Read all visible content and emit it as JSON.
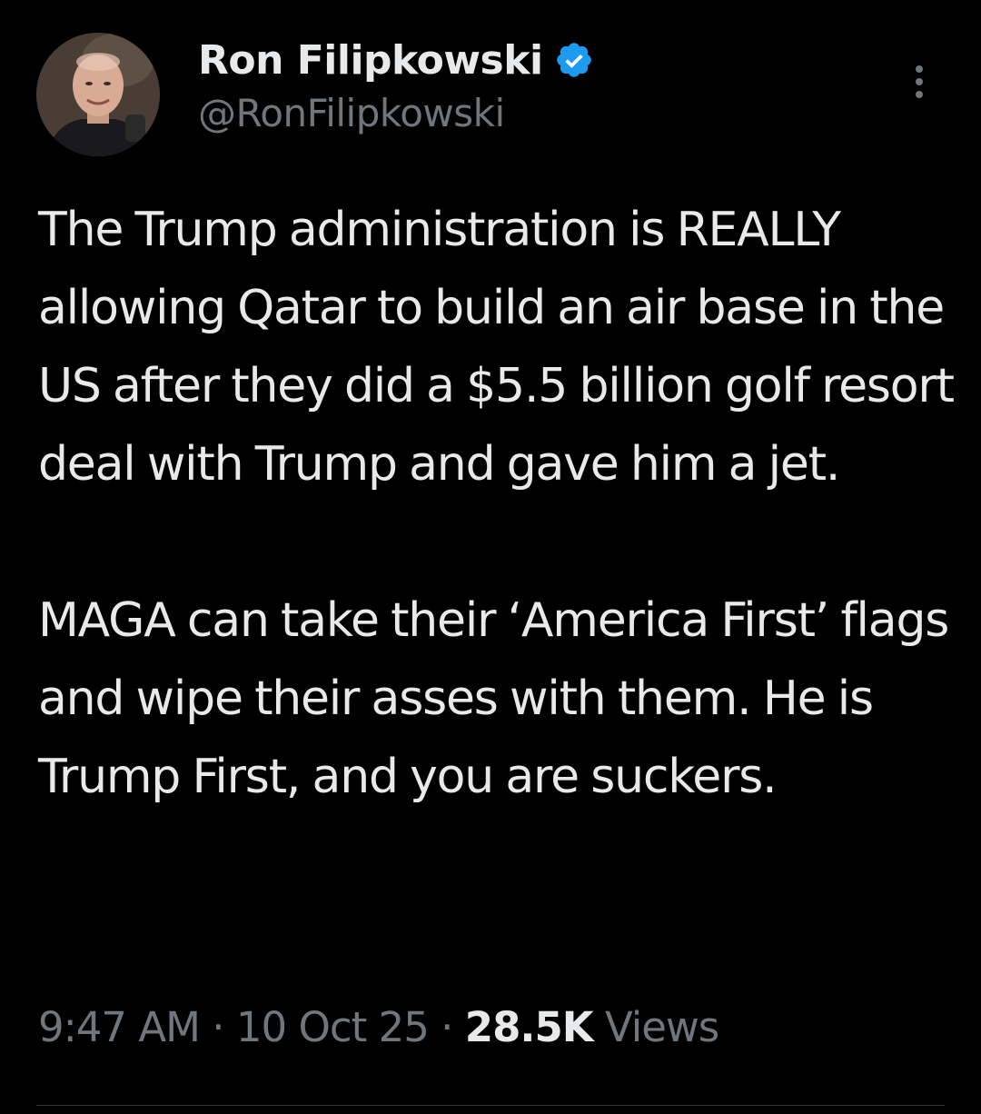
{
  "tweet": {
    "author": {
      "display_name": "Ron Filipkowski",
      "handle": "@RonFilipkowski",
      "verified_icon": "verified-badge-icon",
      "verified_color": "#1d9bf0"
    },
    "body": {
      "paragraph_1": "The Trump administration is REALLY allowing Qatar to build an air base in the US after they did a $5.5 billion golf resort deal with Trump and gave him a jet.",
      "paragraph_2": "MAGA can take their ‘America First’ flags and wipe their asses with them. He is Trump First, and you are suckers."
    },
    "meta": {
      "time": "9:47 AM",
      "separator": "·",
      "date": "10 Oct 25",
      "views_count": "28.5K",
      "views_label": "Views"
    },
    "more_icon": "more-options-icon"
  },
  "colors": {
    "background": "#000000",
    "primary_text": "#e7e9ea",
    "secondary_text": "#71767b",
    "accent": "#1d9bf0"
  }
}
